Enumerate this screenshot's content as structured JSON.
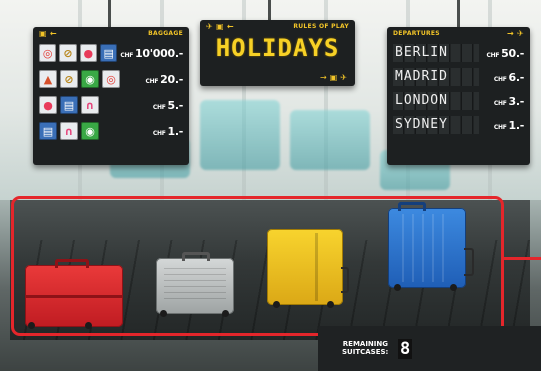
{
  "baggage_board": {
    "title": "BAGGAGE",
    "rows": [
      {
        "items": [
          "ring-buoy",
          "compass",
          "beach-ball",
          "book"
        ],
        "currency": "CHF",
        "amount": "10'000.-"
      },
      {
        "items": [
          "rocket",
          "compass",
          "cash",
          "ring-buoy"
        ],
        "currency": "CHF",
        "amount": "20.-"
      },
      {
        "items": [
          "beach-ball",
          "book",
          "headphones"
        ],
        "currency": "CHF",
        "amount": "5.-"
      },
      {
        "items": [
          "book",
          "headphones",
          "cash"
        ],
        "currency": "CHF",
        "amount": "1.-"
      }
    ]
  },
  "rules_board": {
    "label": "RULES OF PLAY",
    "title": "HOLIDAYS"
  },
  "departures_board": {
    "title": "DEPARTURES",
    "rows": [
      {
        "city": "BERLIN",
        "currency": "CHF",
        "amount": "50.-"
      },
      {
        "city": "MADRID",
        "currency": "CHF",
        "amount": "6.-"
      },
      {
        "city": "LONDON",
        "currency": "CHF",
        "amount": "3.-"
      },
      {
        "city": "SYDNEY",
        "currency": "CHF",
        "amount": "1.-"
      }
    ]
  },
  "suitcases": [
    {
      "color": "red",
      "hex": "#d8252a"
    },
    {
      "color": "silver",
      "hex": "#b9bdbd"
    },
    {
      "color": "yellow",
      "hex": "#f2c321"
    },
    {
      "color": "blue",
      "hex": "#2c74cf"
    }
  ],
  "remaining": {
    "label_line1": "REMAINING",
    "label_line2": "SUITCASES:",
    "value": "8"
  },
  "colors": {
    "accent": "#f2c428",
    "highlight": "#e4262b",
    "board": "#1d2021"
  }
}
